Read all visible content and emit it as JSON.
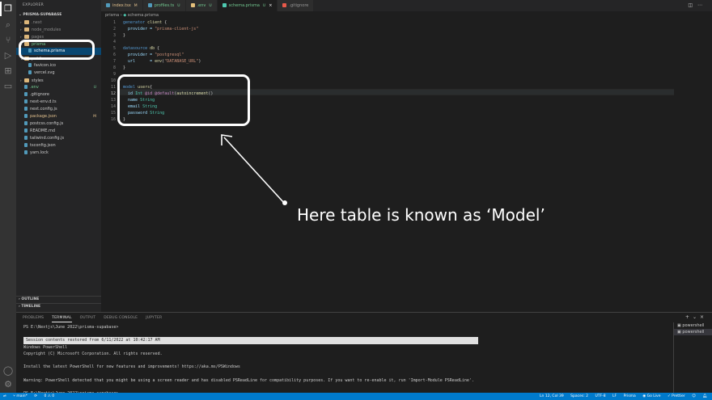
{
  "sidebar": {
    "title": "EXPLORER",
    "root": "PRISMA-SUPABASE",
    "items": [
      {
        "label": ".next",
        "kind": "folder",
        "indent": 1,
        "open": false,
        "color": "#8b8b8b",
        "badge": ""
      },
      {
        "label": "node_modules",
        "kind": "folder",
        "indent": 1,
        "open": false,
        "color": "#8b8b8b",
        "badge": ""
      },
      {
        "label": "pages",
        "kind": "folder",
        "indent": 1,
        "open": false,
        "color": "#8b8b8b",
        "badge": ""
      },
      {
        "label": "prisma",
        "kind": "folder",
        "indent": 1,
        "open": true,
        "color": "#73c991",
        "badge": ""
      },
      {
        "label": "schema.prisma",
        "kind": "file",
        "indent": 2,
        "open": false,
        "color": "#ffffff",
        "badge": "",
        "selected": true
      },
      {
        "label": "public",
        "kind": "folder",
        "indent": 1,
        "open": true,
        "color": "#cccccc",
        "badge": ""
      },
      {
        "label": "favicon.ico",
        "kind": "file",
        "indent": 2,
        "open": false,
        "color": "#cccccc",
        "badge": ""
      },
      {
        "label": "vercel.svg",
        "kind": "file",
        "indent": 2,
        "open": false,
        "color": "#cccccc",
        "badge": ""
      },
      {
        "label": "styles",
        "kind": "folder",
        "indent": 1,
        "open": false,
        "color": "#cccccc",
        "badge": ""
      },
      {
        "label": ".env",
        "kind": "file",
        "indent": 1,
        "open": false,
        "color": "#73c991",
        "badge": "U"
      },
      {
        "label": ".gitignore",
        "kind": "file",
        "indent": 1,
        "open": false,
        "color": "#cccccc",
        "badge": ""
      },
      {
        "label": "next-env.d.ts",
        "kind": "file",
        "indent": 1,
        "open": false,
        "color": "#cccccc",
        "badge": ""
      },
      {
        "label": "next.config.js",
        "kind": "file",
        "indent": 1,
        "open": false,
        "color": "#cccccc",
        "badge": ""
      },
      {
        "label": "package.json",
        "kind": "file",
        "indent": 1,
        "open": false,
        "color": "#e2c08d",
        "badge": "M"
      },
      {
        "label": "postcss.config.js",
        "kind": "file",
        "indent": 1,
        "open": false,
        "color": "#cccccc",
        "badge": ""
      },
      {
        "label": "README.md",
        "kind": "file",
        "indent": 1,
        "open": false,
        "color": "#cccccc",
        "badge": ""
      },
      {
        "label": "tailwind.config.js",
        "kind": "file",
        "indent": 1,
        "open": false,
        "color": "#cccccc",
        "badge": ""
      },
      {
        "label": "tsconfig.json",
        "kind": "file",
        "indent": 1,
        "open": false,
        "color": "#cccccc",
        "badge": ""
      },
      {
        "label": "yarn.lock",
        "kind": "file",
        "indent": 1,
        "open": false,
        "color": "#cccccc",
        "badge": ""
      }
    ],
    "outline": "OUTLINE",
    "timeline": "TIMELINE"
  },
  "tabs": [
    {
      "label": "index.tsx",
      "status": "M",
      "status_color": "#e2c08d",
      "icon_color": "#519aba",
      "active": false
    },
    {
      "label": "profiles.ts",
      "status": "U",
      "status_color": "#73c991",
      "icon_color": "#519aba",
      "active": false
    },
    {
      "label": ".env",
      "status": "U",
      "status_color": "#73c991",
      "icon_color": "#e5c07b",
      "active": false
    },
    {
      "label": "schema.prisma",
      "status": "U",
      "status_color": "#73c991",
      "icon_color": "#4ec9b0",
      "active": true
    },
    {
      "label": ".gitignore",
      "status": "",
      "status_color": "#cccccc",
      "icon_color": "#e8594a",
      "active": false
    }
  ],
  "breadcrumb": {
    "folder": "prisma",
    "file": "schema.prisma"
  },
  "editor": {
    "lines": [
      [
        [
          "generator ",
          "kw"
        ],
        [
          "client ",
          "fn"
        ],
        [
          "{",
          ""
        ]
      ],
      [
        [
          "  provider = ",
          "pr"
        ],
        [
          "\"prisma-client-js\"",
          "str"
        ]
      ],
      [
        [
          "}",
          ""
        ]
      ],
      [
        [
          "",
          ""
        ]
      ],
      [
        [
          "datasource ",
          "kw"
        ],
        [
          "db ",
          "fn"
        ],
        [
          "{",
          ""
        ]
      ],
      [
        [
          "  provider = ",
          "pr"
        ],
        [
          "\"postgresql\"",
          "str"
        ]
      ],
      [
        [
          "  url      = ",
          "pr"
        ],
        [
          "env",
          "fn"
        ],
        [
          "(",
          ""
        ],
        [
          "\"DATABASE_URL\"",
          "str"
        ],
        [
          ")",
          ""
        ]
      ],
      [
        [
          "}",
          ""
        ]
      ],
      [
        [
          "",
          ""
        ]
      ],
      [
        [
          "",
          ""
        ]
      ],
      [
        [
          "model ",
          "kw"
        ],
        [
          "users",
          "fn"
        ],
        [
          "{",
          ""
        ]
      ],
      [
        [
          "  id ",
          "pr"
        ],
        [
          "Int ",
          "ty"
        ],
        [
          "@id ",
          "at"
        ],
        [
          "@default",
          "at"
        ],
        [
          "(",
          ""
        ],
        [
          "autoincrement",
          "fn"
        ],
        [
          "()",
          ""
        ]
      ],
      [
        [
          "  name ",
          "pr"
        ],
        [
          "String",
          "ty"
        ]
      ],
      [
        [
          "  email ",
          "pr"
        ],
        [
          "String",
          "ty"
        ]
      ],
      [
        [
          "  password ",
          "pr"
        ],
        [
          "String",
          "ty"
        ]
      ],
      [
        [
          "}",
          ""
        ]
      ]
    ]
  },
  "annotation": {
    "text": "Here table is known as ‘Model’"
  },
  "panel": {
    "tabs": [
      "PROBLEMS",
      "TERMINAL",
      "OUTPUT",
      "DEBUG CONSOLE",
      "JUPYTER"
    ],
    "active_tab": "TERMINAL",
    "terminal_lines": [
      {
        "text": "PS E:\\Nextjs\\June 2022\\prisma-supabase>",
        "inv": false
      },
      {
        "text": "",
        "inv": false
      },
      {
        "text": " Session contents restored from 6/11/2022 at 10:42:17 AM",
        "inv": true
      },
      {
        "text": "Windows PowerShell",
        "inv": false
      },
      {
        "text": "Copyright (C) Microsoft Corporation. All rights reserved.",
        "inv": false
      },
      {
        "text": "",
        "inv": false
      },
      {
        "text": "Install the latest PowerShell for new features and improvements! https://aka.ms/PSWindows",
        "inv": false
      },
      {
        "text": "",
        "inv": false
      },
      {
        "text": "Warning: PowerShell detected that you might be using a screen reader and has disabled PSReadLine for compatibility purposes. If you want to re-enable it, run 'Import-Module PSReadLine'.",
        "inv": false
      },
      {
        "text": "",
        "inv": false
      },
      {
        "text": "PS E:\\Nextjs\\June 2022\\prisma-supabase>",
        "inv": false
      }
    ],
    "terminals": [
      "powershell",
      "powershell"
    ]
  },
  "status": {
    "branch": "main*",
    "sync": "0 ⚠ 0",
    "ln_col": "Ln 12, Col 39",
    "spaces": "Spaces: 2",
    "encoding": "UTF-8",
    "eol": "LF",
    "language": "Prisma",
    "golive": "Go Live",
    "prettier": "✓ Prettier"
  },
  "colors": {
    "accent": "#007acc",
    "selection": "#094771",
    "annotation": "#ffffff"
  }
}
